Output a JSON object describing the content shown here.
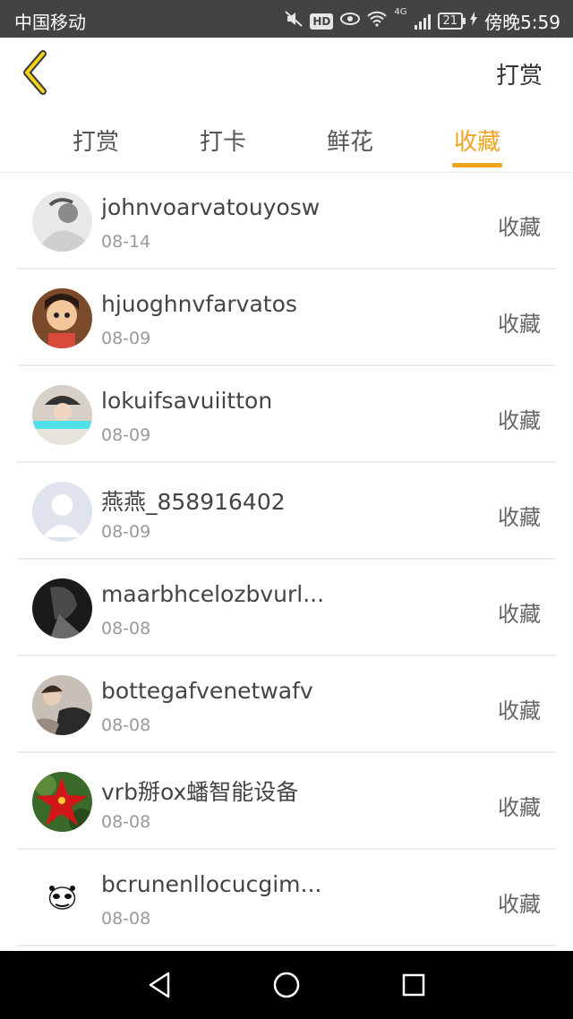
{
  "status_bar": {
    "carrier": "中国移动",
    "icons": [
      "mute-icon",
      "hd-icon",
      "eye-icon",
      "wifi-icon",
      "signal-icon",
      "battery-icon",
      "charging-icon"
    ],
    "hd_label": "HD",
    "network_label": "4G",
    "battery": "21",
    "time": "傍晚5:59"
  },
  "header": {
    "back_icon": "chevron-left-icon",
    "action_label": "打赏",
    "accent_color": "#f0a41f"
  },
  "tabs": [
    {
      "label": "打赏",
      "active": false
    },
    {
      "label": "打卡",
      "active": false
    },
    {
      "label": "鲜花",
      "active": false
    },
    {
      "label": "收藏",
      "active": true
    }
  ],
  "list": [
    {
      "name": "johnvoarvatouyosw",
      "date": "08-14",
      "action": "收藏"
    },
    {
      "name": "hjuoghnvfarvatos",
      "date": "08-09",
      "action": "收藏"
    },
    {
      "name": "lokuifsavuiitton",
      "date": "08-09",
      "action": "收藏"
    },
    {
      "name": "燕燕_858916402",
      "date": "08-09",
      "action": "收藏"
    },
    {
      "name": "maarbhcelozbvurl...",
      "date": "08-08",
      "action": "收藏"
    },
    {
      "name": "bottegafvenetwafv",
      "date": "08-08",
      "action": "收藏"
    },
    {
      "name": "vrb掰ox蟠智能设备",
      "date": "08-08",
      "action": "收藏"
    },
    {
      "name": "bcrunenllocucgim...",
      "date": "08-08",
      "action": "收藏"
    }
  ],
  "nav_bar": {
    "icons": [
      "back-triangle-icon",
      "home-circle-icon",
      "recents-square-icon"
    ]
  }
}
